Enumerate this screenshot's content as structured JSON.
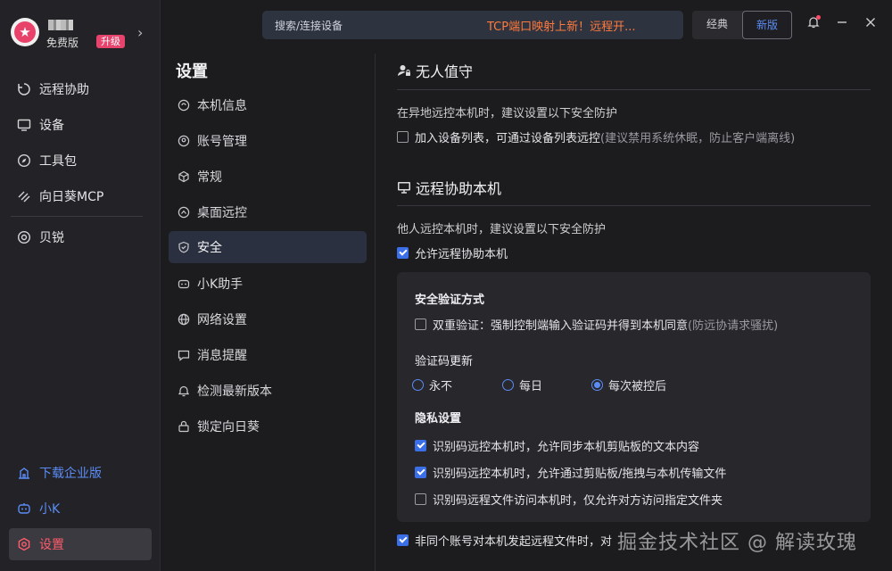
{
  "profile": {
    "username": "■■■",
    "plan": "免费版",
    "upgrade": "升级"
  },
  "nav": {
    "items": [
      {
        "label": "远程协助",
        "icon": "remote-assist-icon"
      },
      {
        "label": "设备",
        "icon": "monitor-icon"
      },
      {
        "label": "工具包",
        "icon": "compass-icon"
      },
      {
        "label": "向日葵MCP",
        "icon": "mcp-icon"
      },
      {
        "label": "贝锐",
        "icon": "oray-icon"
      }
    ],
    "bottom": [
      {
        "label": "下载企业版",
        "icon": "enterprise-icon"
      },
      {
        "label": "小K",
        "icon": "robot-icon"
      },
      {
        "label": "设置",
        "icon": "gear-icon"
      }
    ]
  },
  "topbar": {
    "search_placeholder": "搜索/连接设备",
    "promo": "TCP端口映射上新！远程开...",
    "version_classic": "经典",
    "version_new": "新版"
  },
  "settings": {
    "title": "设置",
    "menu": [
      {
        "label": "本机信息",
        "icon": "info-icon"
      },
      {
        "label": "账号管理",
        "icon": "user-icon"
      },
      {
        "label": "常规",
        "icon": "cube-icon"
      },
      {
        "label": "桌面远控",
        "icon": "desktop-icon"
      },
      {
        "label": "安全",
        "icon": "shield-icon",
        "active": true
      },
      {
        "label": "小K助手",
        "icon": "robot-icon"
      },
      {
        "label": "网络设置",
        "icon": "globe-icon"
      },
      {
        "label": "消息提醒",
        "icon": "message-icon"
      },
      {
        "label": "检测最新版本",
        "icon": "update-icon"
      },
      {
        "label": "锁定向日葵",
        "icon": "lock-icon"
      }
    ]
  },
  "unattended": {
    "title": "无人值守",
    "desc": "在异地远控本机时，建议设置以下安全防护",
    "option_label": "加入设备列表，可通过设备列表远控",
    "option_hint": "(建议禁用系统休眠，防止客户端离线)",
    "option_checked": false
  },
  "remote_assist": {
    "title": "远程协助本机",
    "desc": "他人远控本机时，建议设置以下安全防护",
    "allow_label": "允许远程协助本机",
    "allow_checked": true,
    "verify_title": "安全验证方式",
    "dual_label": "双重验证：强制控制端输入验证码并得到本机同意",
    "dual_hint": "(防远协请求骚扰)",
    "dual_checked": false,
    "code_update_title": "验证码更新",
    "code_options": [
      "永不",
      "每日",
      "每次被控后"
    ],
    "code_selected": "每次被控后",
    "privacy_title": "隐私设置",
    "privacy_options": [
      {
        "label": "识别码远控本机时，允许同步本机剪贴板的文本内容",
        "checked": true
      },
      {
        "label": "识别码远控本机时，允许通过剪贴板/拖拽与本机传输文件",
        "checked": true
      },
      {
        "label": "识别码远程文件访问本机时，仅允许对方访问指定文件夹",
        "checked": false
      }
    ],
    "cross_account_label": "非同个账号对本机发起远程文件时，对",
    "cross_account_checked": true
  },
  "watermark": "掘金技术社区 @ 解读玫瑰"
}
